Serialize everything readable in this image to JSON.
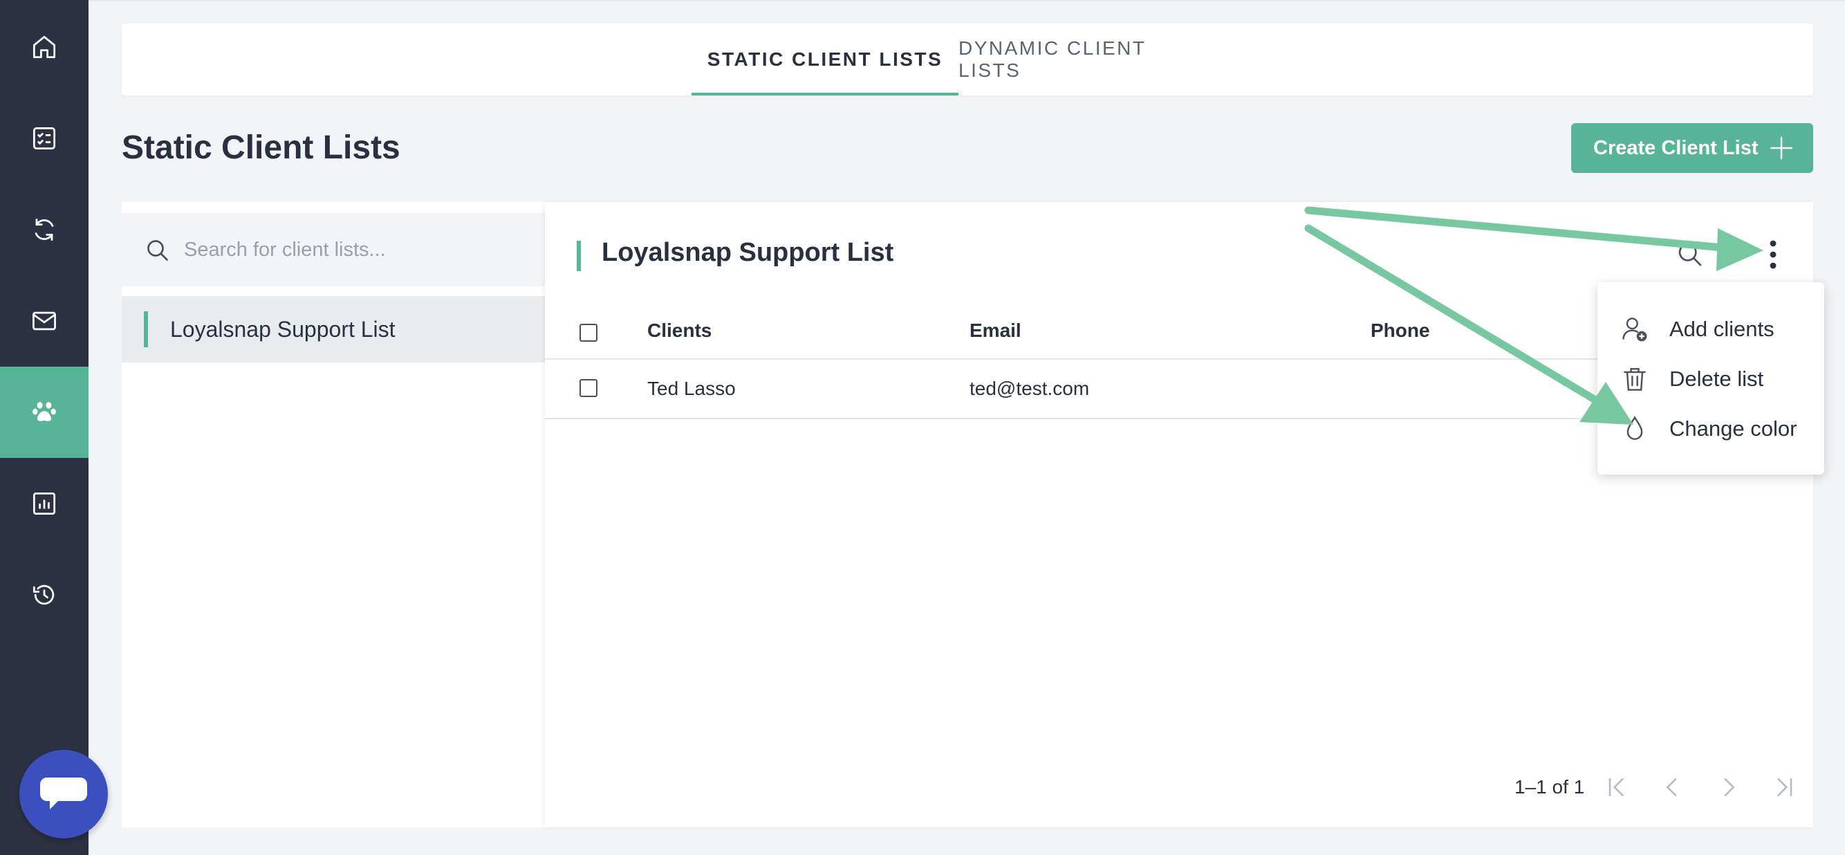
{
  "colors": {
    "sidebar": "#2c3144",
    "accent": "#58b497",
    "chat": "#3c4fbf",
    "arrow": "#77c7a0"
  },
  "sidebar": {
    "items": [
      {
        "icon": "home-icon"
      },
      {
        "icon": "checklist-icon"
      },
      {
        "icon": "refresh-icon"
      },
      {
        "icon": "mail-icon"
      },
      {
        "icon": "paw-icon",
        "active": true
      },
      {
        "icon": "chart-icon"
      },
      {
        "icon": "history-icon"
      }
    ],
    "chat_icon": "chat-bubble-icon"
  },
  "tabs": [
    {
      "label": "STATIC CLIENT LISTS",
      "active": true
    },
    {
      "label": "DYNAMIC CLIENT LISTS",
      "active": false
    }
  ],
  "page": {
    "title": "Static Client Lists",
    "create_label": "Create Client List"
  },
  "list_panel": {
    "search_placeholder": "Search for client lists...",
    "items": [
      {
        "label": "Loyalsnap Support List",
        "selected": true
      }
    ]
  },
  "detail": {
    "title": "Loyalsnap Support List",
    "columns": [
      "Clients",
      "Email",
      "Phone"
    ],
    "rows": [
      {
        "client": "Ted Lasso",
        "email": "ted@test.com",
        "phone": ""
      }
    ],
    "pagination": "1–1 of 1"
  },
  "menu": {
    "items": [
      {
        "label": "Add clients",
        "icon": "add-user-icon"
      },
      {
        "label": "Delete list",
        "icon": "trash-icon"
      },
      {
        "label": "Change color",
        "icon": "droplet-icon"
      }
    ]
  }
}
